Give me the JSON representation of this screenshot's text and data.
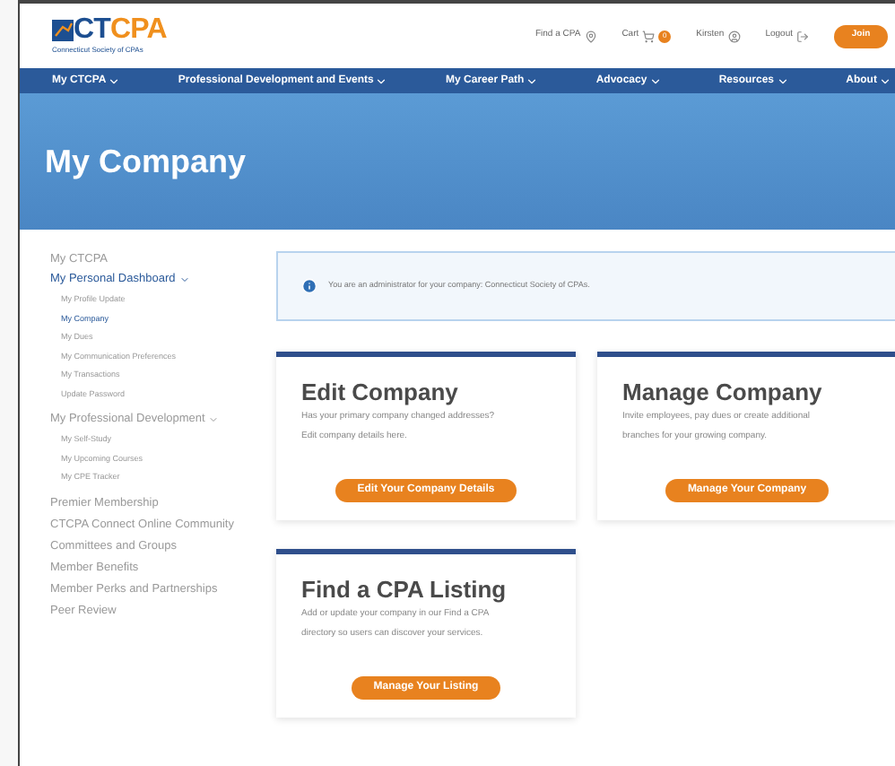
{
  "logo": {
    "parts": [
      {
        "text": "CT",
        "color": "#1d4f91"
      },
      {
        "text": "CPA",
        "color": "#f0901e"
      }
    ],
    "tagline": "Connecticut Society of CPAs"
  },
  "top_links": [
    {
      "label": "Find a CPA",
      "kind": "pin"
    },
    {
      "label": "Cart",
      "kind": "cart",
      "badge": "0"
    },
    {
      "label": "Kirsten",
      "kind": "user"
    },
    {
      "label": "Logout",
      "kind": "logout"
    }
  ],
  "join_button": "Join",
  "nav": [
    "My CTCPA",
    "Professional Development and Events",
    "My Career Path",
    "Advocacy",
    "Resources",
    "About"
  ],
  "page_title": "My Company",
  "sidebar": {
    "heading": "My CTCPA",
    "sections": [
      {
        "label": "My Personal Dashboard",
        "expanded": true,
        "selected": true,
        "children": [
          {
            "label": "My Profile Update",
            "selected": false
          },
          {
            "label": "My Company",
            "selected": true
          },
          {
            "label": "My Dues",
            "selected": false
          },
          {
            "label": "My Communication Preferences",
            "selected": false
          },
          {
            "label": "My Transactions",
            "selected": false
          },
          {
            "label": "Update Password",
            "selected": false
          }
        ]
      },
      {
        "label": "My Professional Development",
        "expanded": true,
        "selected": false,
        "children": [
          {
            "label": "My Self-Study",
            "selected": false
          },
          {
            "label": "My Upcoming Courses",
            "selected": false
          },
          {
            "label": "My CPE Tracker",
            "selected": false
          }
        ]
      },
      {
        "label": "Premier Membership",
        "selected": false
      },
      {
        "label": "CTCPA Connect Online Community",
        "selected": false
      },
      {
        "label": "Committees and Groups",
        "selected": false
      },
      {
        "label": "Member Benefits",
        "selected": false
      },
      {
        "label": "Member Perks and Partnerships",
        "selected": false
      },
      {
        "label": "Peer Review",
        "selected": false
      }
    ]
  },
  "notice": "You are an administrator for your company: Connecticut Society of CPAs.",
  "cards": [
    {
      "title": "Edit Company",
      "lines": [
        "Has your primary company changed addresses?",
        "Edit company details here."
      ],
      "button": "Edit Your Company Details"
    },
    {
      "title": "Manage Company",
      "lines": [
        "Invite employees, pay dues or create additional",
        "branches for your growing company."
      ],
      "button": "Manage Your Company"
    },
    {
      "title": "Find a CPA Listing",
      "lines": [
        "Add or update your company in our Find a CPA",
        "directory so users can discover your services."
      ],
      "button": "Manage Your Listing"
    }
  ]
}
